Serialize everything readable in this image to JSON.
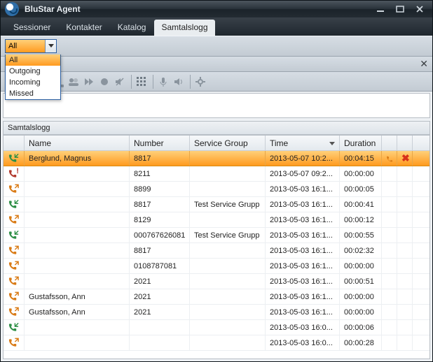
{
  "title": "BluStar Agent",
  "tabs": [
    "Sessioner",
    "Kontakter",
    "Katalog",
    "Samtalslogg"
  ],
  "selected_tab_index": 3,
  "filter": {
    "selected": "All",
    "options": [
      "All",
      "Outgoing",
      "Incoming",
      "Missed"
    ]
  },
  "section_title": "Samtalslogg",
  "columns": {
    "name": "Name",
    "number": "Number",
    "service": "Service Group",
    "time": "Time",
    "duration": "Duration"
  },
  "sorted_column": "time",
  "sort_dir": "desc",
  "rows": [
    {
      "dir": "in_ok",
      "name": "Berglund, Magnus",
      "number": "8817",
      "service": "",
      "time": "2013-05-07 10:2...",
      "duration": "00:04:15",
      "selected": true
    },
    {
      "dir": "missed",
      "name": "",
      "number": "8211",
      "service": "",
      "time": "2013-05-07 09:2...",
      "duration": "00:00:00"
    },
    {
      "dir": "out",
      "name": "",
      "number": "8899",
      "service": "",
      "time": "2013-05-03 16:1...",
      "duration": "00:00:05"
    },
    {
      "dir": "in_ok",
      "name": "",
      "number": "8817",
      "service": "Test Service Grupp",
      "time": "2013-05-03 16:1...",
      "duration": "00:00:41"
    },
    {
      "dir": "out",
      "name": "",
      "number": "8129",
      "service": "",
      "time": "2013-05-03 16:1...",
      "duration": "00:00:12"
    },
    {
      "dir": "in_ok",
      "name": "",
      "number": "000767626081",
      "service": "Test Service Grupp",
      "time": "2013-05-03 16:1...",
      "duration": "00:00:55"
    },
    {
      "dir": "out",
      "name": "",
      "number": "8817",
      "service": "",
      "time": "2013-05-03 16:1...",
      "duration": "00:02:32"
    },
    {
      "dir": "out",
      "name": "",
      "number": "0108787081",
      "service": "",
      "time": "2013-05-03 16:1...",
      "duration": "00:00:00"
    },
    {
      "dir": "out",
      "name": "",
      "number": "2021",
      "service": "",
      "time": "2013-05-03 16:1...",
      "duration": "00:00:51"
    },
    {
      "dir": "out",
      "name": "Gustafsson, Ann",
      "number": "2021",
      "service": "",
      "time": "2013-05-03 16:1...",
      "duration": "00:00:00"
    },
    {
      "dir": "out",
      "name": "Gustafsson, Ann",
      "number": "2021",
      "service": "",
      "time": "2013-05-03 16:1...",
      "duration": "00:00:00"
    },
    {
      "dir": "in_ok",
      "name": "",
      "number": "",
      "service": "",
      "time": "2013-05-03 16:0...",
      "duration": "00:00:06"
    },
    {
      "dir": "out",
      "name": "",
      "number": "",
      "service": "",
      "time": "2013-05-03 16:0...",
      "duration": "00:00:28"
    }
  ],
  "toolbar_icons": [
    "phone-answer-icon",
    "phone-redial-icon",
    "phone-hangup-icon",
    "phone-hold-icon",
    "conference-icon",
    "fast-forward-icon",
    "record-icon",
    "mute-icon",
    "sep",
    "dialpad-icon",
    "sep",
    "mic-icon",
    "speaker-icon",
    "sep",
    "settings-icon"
  ]
}
